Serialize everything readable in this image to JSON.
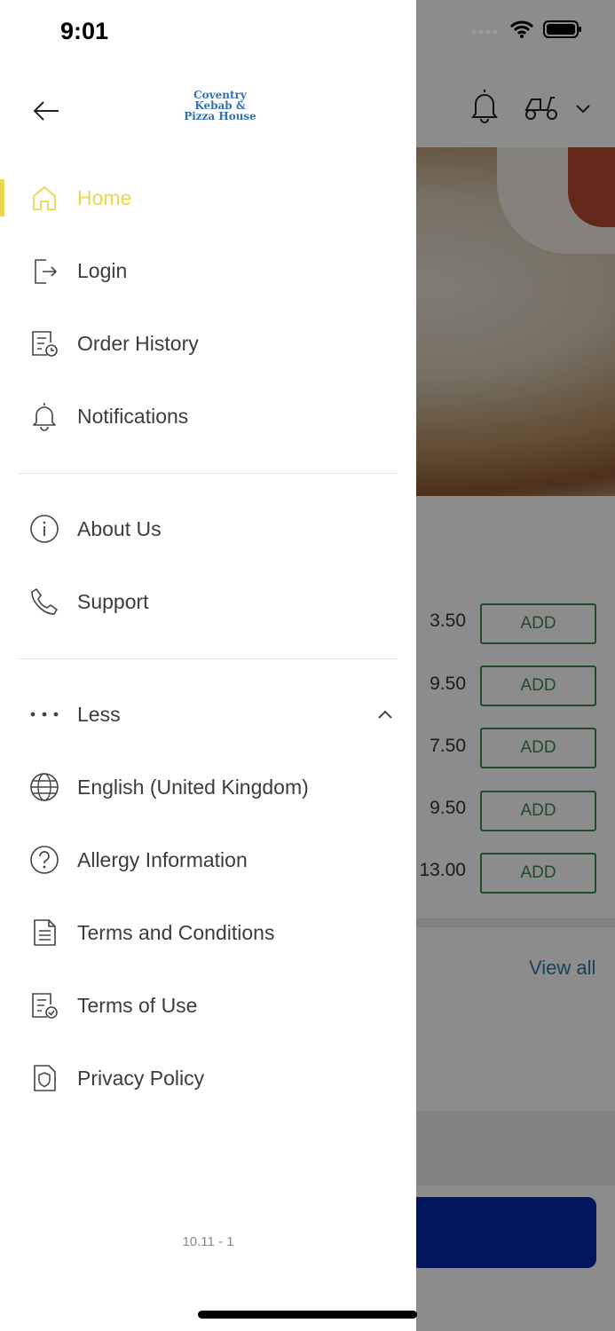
{
  "status_bar": {
    "time": "9:01"
  },
  "drawer": {
    "logo_text": [
      "Coventry",
      "Kebab &",
      "Pizza House"
    ],
    "primary_items": [
      {
        "label": "Home",
        "icon": "home-icon",
        "active": true
      },
      {
        "label": "Login",
        "icon": "login-icon",
        "active": false
      },
      {
        "label": "Order History",
        "icon": "order-history-icon",
        "active": false
      },
      {
        "label": "Notifications",
        "icon": "bell-icon",
        "active": false
      }
    ],
    "secondary_items": [
      {
        "label": "About Us",
        "icon": "info-icon"
      },
      {
        "label": "Support",
        "icon": "phone-icon"
      }
    ],
    "more_toggle": {
      "label": "Less",
      "icon": "more-dots-icon",
      "expanded": true
    },
    "extra_items": [
      {
        "label": "English (United Kingdom)",
        "icon": "globe-icon"
      },
      {
        "label": "Allergy Information",
        "icon": "question-icon"
      },
      {
        "label": "Terms and Conditions",
        "icon": "document-icon"
      },
      {
        "label": "Terms of Use",
        "icon": "document-check-icon"
      },
      {
        "label": "Privacy Policy",
        "icon": "shield-icon"
      }
    ],
    "version": "10.11 - 1"
  },
  "background": {
    "prices": [
      "3.50",
      "9.50",
      "7.50",
      "9.50",
      "13.00"
    ],
    "add_label": "ADD",
    "view_all": "View all"
  },
  "colors": {
    "accent": "#ECD64A",
    "add_green": "#3B8A4F",
    "cta_blue": "#0027A8",
    "link_blue": "#2A7AA8"
  }
}
